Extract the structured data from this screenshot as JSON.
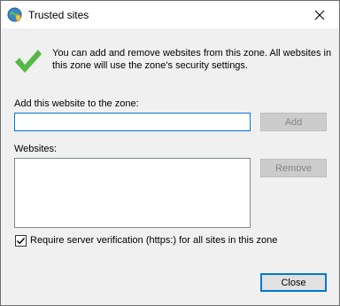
{
  "window": {
    "title": "Trusted sites"
  },
  "info": {
    "text": "You can add and remove websites from this zone. All websites in this zone will use the zone's security settings."
  },
  "add_site": {
    "label": "Add this website to the zone:",
    "value": "",
    "add_button": "Add"
  },
  "websites": {
    "label": "Websites:",
    "items": [],
    "remove_button": "Remove"
  },
  "https_option": {
    "label": "Require server verification (https:) for all sites in this zone",
    "checked": true
  },
  "footer": {
    "close_button": "Close"
  },
  "icons": {
    "title": "globe-shield-icon",
    "info": "checkmark-icon",
    "close": "close-icon"
  },
  "colors": {
    "accent": "#0078d7",
    "check_green": "#4caf50"
  }
}
